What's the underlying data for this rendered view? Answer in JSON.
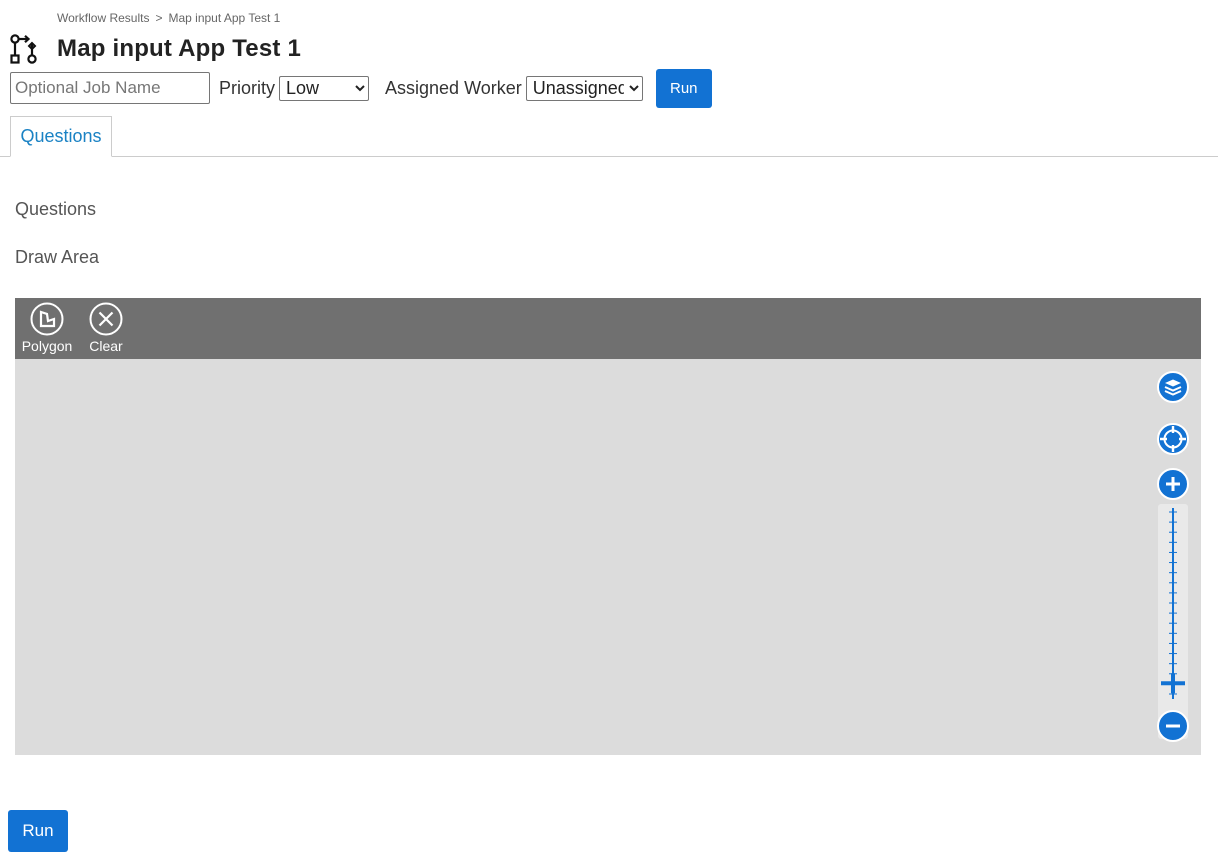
{
  "breadcrumb": {
    "items": [
      "Workflow Results",
      "Map input App Test 1"
    ],
    "separator": ">"
  },
  "header": {
    "title": "Map input App Test 1",
    "icon": "workflow-icon"
  },
  "controls": {
    "job_name_placeholder": "Optional Job Name",
    "job_name_value": "",
    "priority_label": "Priority",
    "priority_selected": "Low",
    "worker_label": "Assigned Worker",
    "worker_selected": "Unassigned",
    "run_label": "Run"
  },
  "tabs": [
    {
      "label": "Questions",
      "active": true
    }
  ],
  "content": {
    "section_label": "Questions",
    "draw_area_label": "Draw Area"
  },
  "map": {
    "tools": [
      {
        "label": "Polygon",
        "icon": "polygon-icon"
      },
      {
        "label": "Clear",
        "icon": "clear-icon"
      }
    ],
    "controls": [
      "layers-icon",
      "locate-icon",
      "zoom-in-icon",
      "zoom-slider",
      "zoom-out-icon"
    ],
    "zoom_level_fraction": 0.07
  },
  "footer": {
    "run_label": "Run"
  },
  "colors": {
    "primary": "#1272d3",
    "tab_text": "#1a82c4",
    "toolbar_bg": "#707070",
    "map_bg": "#dcdcdc"
  }
}
